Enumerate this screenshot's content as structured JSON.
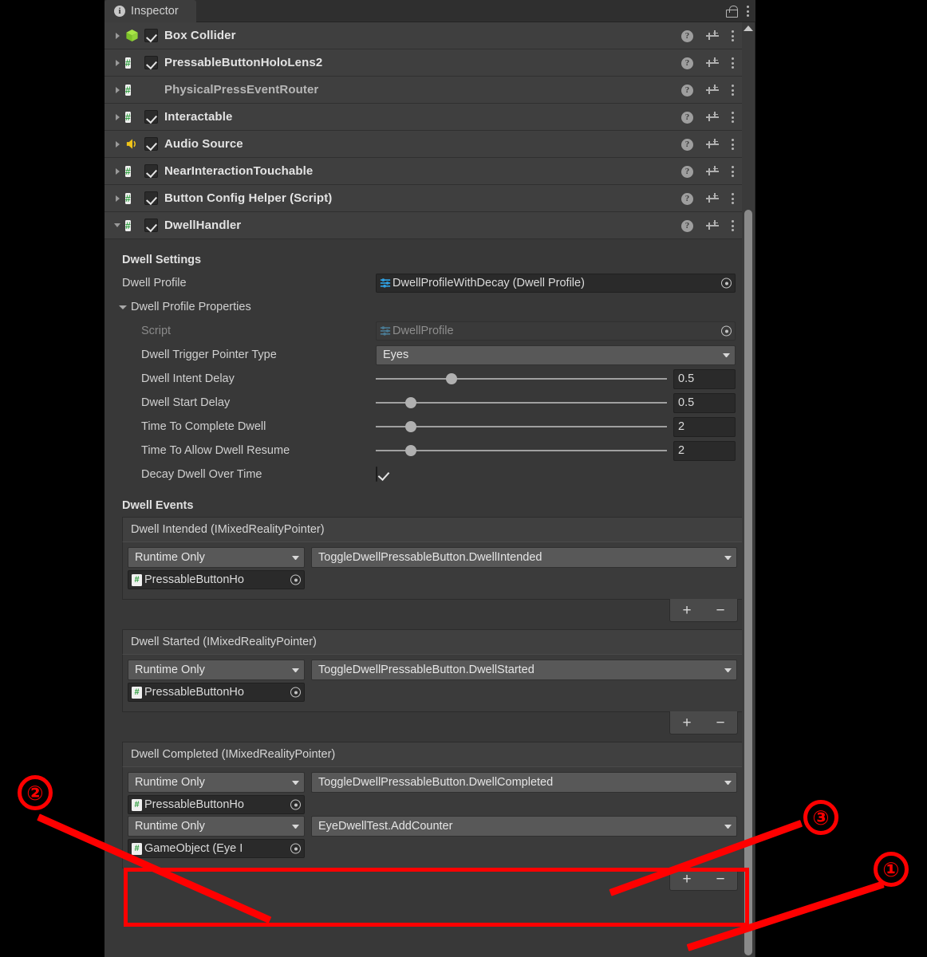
{
  "window": {
    "tab_label": "Inspector",
    "tab_icon": "info-icon",
    "lock_icon": "lock-icon",
    "menu_icon": "kebab-menu-icon"
  },
  "components": [
    {
      "name": "Box Collider",
      "icon": "box-collider-icon",
      "expanded": false,
      "enabled": true,
      "has_checkbox": true
    },
    {
      "name": "PressableButtonHoloLens2",
      "icon": "script-icon",
      "expanded": false,
      "enabled": true,
      "has_checkbox": true
    },
    {
      "name": "PhysicalPressEventRouter",
      "icon": "script-icon",
      "expanded": false,
      "enabled": false,
      "has_checkbox": false
    },
    {
      "name": "Interactable",
      "icon": "script-icon",
      "expanded": false,
      "enabled": true,
      "has_checkbox": true
    },
    {
      "name": "Audio Source",
      "icon": "audio-source-icon",
      "expanded": false,
      "enabled": true,
      "has_checkbox": true
    },
    {
      "name": "NearInteractionTouchable",
      "icon": "script-icon",
      "expanded": false,
      "enabled": true,
      "has_checkbox": true
    },
    {
      "name": "Button Config Helper (Script)",
      "icon": "script-icon",
      "expanded": false,
      "enabled": true,
      "has_checkbox": true
    },
    {
      "name": "DwellHandler",
      "icon": "script-icon",
      "expanded": true,
      "enabled": true,
      "has_checkbox": true
    }
  ],
  "row_tools": {
    "help": "help-icon",
    "preset": "preset-icon",
    "menu": "kebab-menu-icon"
  },
  "dwell_settings": {
    "title": "Dwell Settings",
    "dwell_profile_label": "Dwell Profile",
    "dwell_profile_value": "DwellProfileWithDecay (Dwell Profile)",
    "profile_properties_label": "Dwell Profile Properties",
    "script_label": "Script",
    "script_value": "DwellProfile",
    "pointer_type_label": "Dwell Trigger Pointer Type",
    "pointer_type_value": "Eyes",
    "sliders": [
      {
        "label": "Dwell Intent Delay",
        "value": "0.5",
        "knob_pct": 26
      },
      {
        "label": "Dwell Start Delay",
        "value": "0.5",
        "knob_pct": 12
      },
      {
        "label": "Time To Complete Dwell",
        "value": "2",
        "knob_pct": 12
      },
      {
        "label": "Time To Allow Dwell Resume",
        "value": "2",
        "knob_pct": 12
      }
    ],
    "decay_label": "Decay Dwell Over Time",
    "decay_checked": true
  },
  "dwell_events": {
    "title": "Dwell Events",
    "blocks": [
      {
        "header": "Dwell Intended (IMixedRealityPointer)",
        "entries": [
          {
            "mode": "Runtime Only",
            "function": "ToggleDwellPressableButton.DwellIntended",
            "object": "PressableButtonHo",
            "highlight": false
          }
        ],
        "add_label": "+",
        "remove_label": "−"
      },
      {
        "header": "Dwell Started (IMixedRealityPointer)",
        "entries": [
          {
            "mode": "Runtime Only",
            "function": "ToggleDwellPressableButton.DwellStarted",
            "object": "PressableButtonHo",
            "highlight": false
          }
        ],
        "add_label": "+",
        "remove_label": "−"
      },
      {
        "header": "Dwell Completed (IMixedRealityPointer)",
        "entries": [
          {
            "mode": "Runtime Only",
            "function": "ToggleDwellPressableButton.DwellCompleted",
            "object": "PressableButtonHo",
            "highlight": false
          },
          {
            "mode": "Runtime Only",
            "function": "EyeDwellTest.AddCounter",
            "object": "GameObject (Eye I",
            "highlight": true
          }
        ],
        "add_label": "+",
        "remove_label": "−"
      }
    ]
  },
  "annotations": {
    "color": "#ff0000",
    "markers": [
      {
        "id": "marker-1",
        "label": "①"
      },
      {
        "id": "marker-2",
        "label": "②"
      },
      {
        "id": "marker-3",
        "label": "③"
      }
    ]
  }
}
